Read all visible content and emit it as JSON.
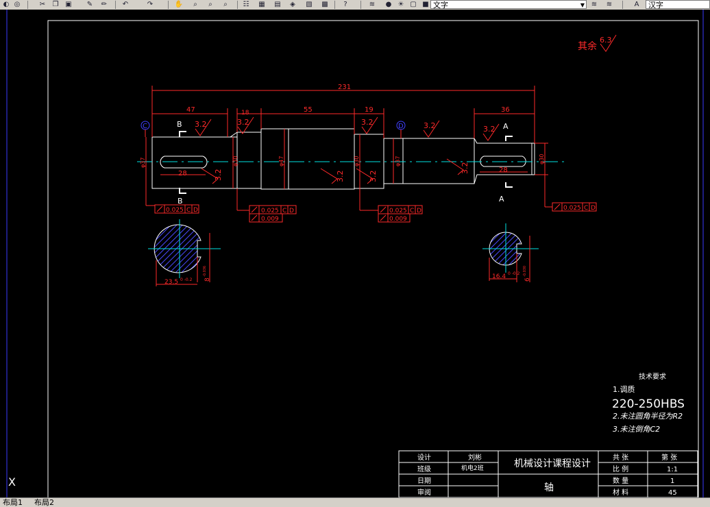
{
  "toolbar": {
    "layer_combo_value": "文字",
    "style_combo_value": "汉字",
    "icons": [
      "open-icon",
      "web-icon",
      "cut-icon",
      "copy-icon",
      "paste-icon",
      "brush-icon",
      "match-prop-icon",
      "undo-icon",
      "redo-icon",
      "pan-icon",
      "zoom-realtime-icon",
      "zoom-window-icon",
      "zoom-previous-icon",
      "properties-icon",
      "design-center-icon",
      "tool-palette-icon",
      "sheet-set-icon",
      "markup-icon",
      "calculator-icon",
      "help-icon",
      "layer-manager-icon",
      "layer-state-icons",
      "layer-previous-icon",
      "text-style-icon"
    ]
  },
  "tabs": {
    "layout1": "布局1",
    "layout2": "布局2"
  },
  "drawing": {
    "roughness_other_label": "其余",
    "roughness_other_value": "6.3",
    "dim_overall": "231",
    "dim_47": "47",
    "dim_18": "18",
    "dim_55": "55",
    "dim_19": "19",
    "dim_36": "36",
    "dim_28a": "28",
    "dim_28b": "28",
    "dia_left": "φ37",
    "dia_30a": "φ30",
    "dia_47": "φ47",
    "dia_30b": "φ30",
    "dia_37": "φ37",
    "dia_right": "φ30",
    "roughness_32": "3.2",
    "datum_c": "C",
    "datum_d": "D",
    "section_b": "B",
    "section_a": "A",
    "tol_runout": "0.025",
    "tol_cyl": "0.009",
    "tol_ref_c": "C",
    "tol_ref_d": "D",
    "sec_b_dim": "23.5",
    "sec_b_tol": "0\n-0.2",
    "sec_b_width": "8",
    "sec_b_width_tol": "-0.036",
    "sec_a_dim": "16.4",
    "sec_a_tol": "0\n-0.2",
    "sec_a_width": "6",
    "sec_a_width_tol": "-0.030"
  },
  "tech_requirements": {
    "title": "技术要求",
    "line1": "1.调质",
    "line1b": "220-250HBS",
    "line2": "2.未注圆角半径为R2",
    "line3": "3.未注倒角C2"
  },
  "title_block": {
    "design_label": "设计",
    "design_value": "刘彬",
    "class_label": "班级",
    "class_value": "机电2班",
    "date_label": "日期",
    "review_label": "审阅",
    "course_title": "机械设计课程设计",
    "part_name": "轴",
    "total_label": "共 张",
    "sheet_label": "第 张",
    "scale_label": "比 例",
    "scale_value": "1:1",
    "qty_label": "数 量",
    "qty_value": "1",
    "material_label": "材 料",
    "material_value": "45"
  },
  "colors": {
    "red": "#ff2a2a",
    "white": "#ffffff",
    "cyan": "#00e5e5",
    "blue": "#4040ff",
    "hatch": "#4a4aff"
  }
}
